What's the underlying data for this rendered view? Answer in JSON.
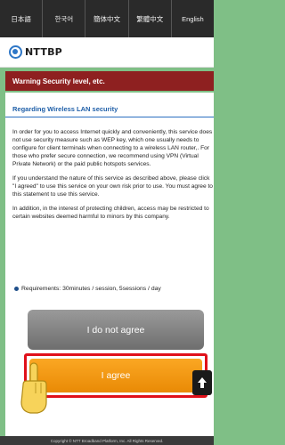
{
  "language_tabs": [
    "日本語",
    "한국어",
    "簡体中文",
    "繁體中文",
    "English"
  ],
  "logo": {
    "text": "NTTBP",
    "icon": "nttbp-logo-icon"
  },
  "warning": "Warning Security level, etc.",
  "section_title": "Regarding Wireless LAN security",
  "paragraphs": [
    "In order for you to access Internet quickly and conveniently, this service does not use security measure such as WEP key, which one usually needs to configure for client terminals when connecting to a wireless LAN router,. For those who prefer secure connection, we recommend using VPN (Virtual Private Network) or the paid public hotspots services.",
    "If you understand the nature of this service as described above, please click \"I agreed\" to use this service on your own risk prior to use. You must agree to this statement to use this service.",
    "In addition, in the interest of protecting children, access may be restricted to certain websites deemed harmful to minors by this company."
  ],
  "requirements": "Requirements: 30minutes / session, 5sessions / day",
  "buttons": {
    "disagree": "I do not agree",
    "agree": "I agree"
  },
  "footer": "Copyright © NTT Broadband Platform, Inc. All Rights Reserved.",
  "icons": {
    "scroll_top": "arrow-up-icon",
    "pointer": "pointing-hand-icon"
  },
  "colors": {
    "warning_bg": "#8e2020",
    "agree": "#f59a12",
    "highlight": "#e0101a",
    "link_blue": "#1f5fa8"
  }
}
